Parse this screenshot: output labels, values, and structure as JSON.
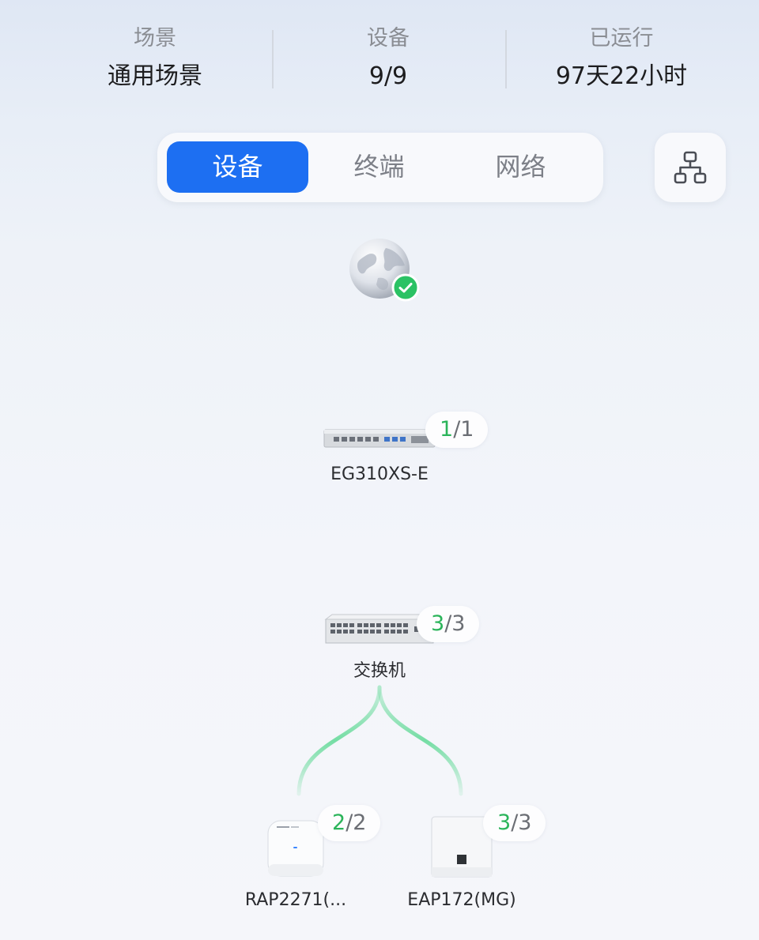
{
  "stats": [
    {
      "label": "场景",
      "value": "通用场景"
    },
    {
      "label": "设备",
      "value": "9/9"
    },
    {
      "label": "已运行",
      "value": "97天22小时"
    }
  ],
  "tabs": [
    {
      "label": "设备",
      "active": true
    },
    {
      "label": "终端",
      "active": false
    },
    {
      "label": "网络",
      "active": false
    }
  ],
  "topology_button_icon": "topology-icon",
  "colors": {
    "accent": "#1d6ff2",
    "link": "#6fdca0",
    "online": "#2bb45a"
  },
  "nodes": {
    "internet": {
      "icon": "globe-icon",
      "status": "online-check-icon"
    },
    "gateway": {
      "name": "EG310XS-E",
      "online": "1",
      "total": "1"
    },
    "switch": {
      "name": "交换机",
      "online": "3",
      "total": "3"
    },
    "ap1": {
      "name": "RAP2271(...",
      "online": "2",
      "total": "2"
    },
    "ap2": {
      "name": "EAP172(MG)",
      "online": "3",
      "total": "3"
    }
  }
}
